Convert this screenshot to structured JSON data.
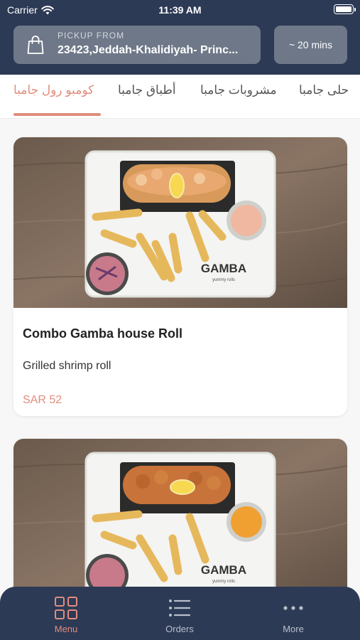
{
  "status_bar": {
    "carrier": "Carrier",
    "time": "11:39 AM"
  },
  "header": {
    "pickup_label": "PICKUP FROM",
    "pickup_address": "23423,Jeddah-Khalidiyah- Princ...",
    "eta": "~ 20 mins"
  },
  "tabs": [
    {
      "label": "كومبو رول جامبا",
      "active": true
    },
    {
      "label": "أطباق جامبا",
      "active": false
    },
    {
      "label": "مشروبات جامبا",
      "active": false
    },
    {
      "label": "حلى جامبا",
      "active": false
    }
  ],
  "menu_items": [
    {
      "name": "Combo Gamba house Roll",
      "description": "Grilled shrimp roll",
      "price": "SAR 52",
      "tray_brand": "GAMBA",
      "tray_tagline": "yummy rolls"
    },
    {
      "tray_brand": "GAMBA",
      "tray_tagline": "yummy rolls"
    }
  ],
  "bottom_nav": [
    {
      "label": "Menu",
      "icon": "grid-icon",
      "active": true
    },
    {
      "label": "Orders",
      "icon": "list-icon",
      "active": false
    },
    {
      "label": "More",
      "icon": "more-dots-icon",
      "active": false
    }
  ],
  "colors": {
    "header_bg": "#2d3a55",
    "accent": "#e08d7d",
    "card_bg": "#ffffff",
    "page_bg": "#f7f7f7"
  }
}
